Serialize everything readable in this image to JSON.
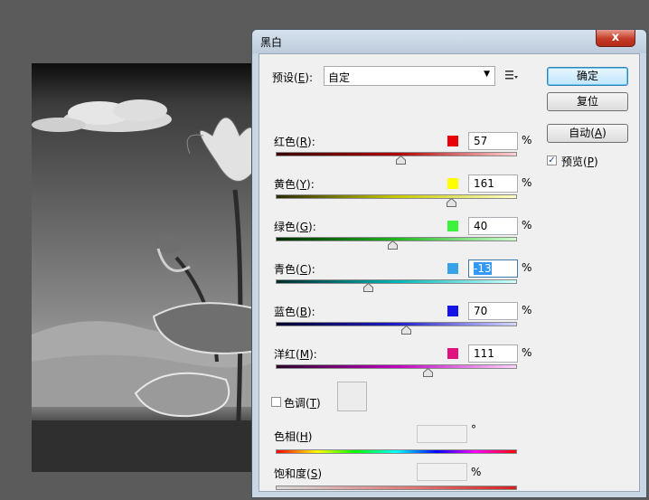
{
  "dialog": {
    "title": "黑白",
    "close_symbol": "x",
    "preset": {
      "label": "预设",
      "key": "E",
      "value": "自定"
    },
    "buttons": {
      "ok": "确定",
      "reset": "复位",
      "auto": "自动",
      "auto_key": "A"
    },
    "preview": {
      "label": "预览",
      "key": "P",
      "checked": true
    },
    "sliders": [
      {
        "label": "红色",
        "key": "R",
        "value": "57",
        "swatch": "#e8000b",
        "track": "linear-gradient(90deg,#3a0000,#b00000 50%,#ffd2d2)",
        "percent": "%",
        "thumb_fraction": 0.515
      },
      {
        "label": "黄色",
        "key": "Y",
        "value": "161",
        "swatch": "#ffff00",
        "track": "linear-gradient(90deg,#2a2a00,#c9c900 50%,#ffffc8)",
        "percent": "%",
        "thumb_fraction": 0.725
      },
      {
        "label": "绿色",
        "key": "G",
        "value": "40",
        "swatch": "#3cf23c",
        "track": "linear-gradient(90deg,#002a00,#1fb51f 50%,#d0ffd0)",
        "percent": "%",
        "thumb_fraction": 0.483
      },
      {
        "label": "青色",
        "key": "C",
        "value": "-13",
        "swatch": "#36a3e6",
        "track": "linear-gradient(90deg,#002a2a,#00b5b5 50%,#cfffff)",
        "percent": "%",
        "thumb_fraction": 0.383,
        "focused": true
      },
      {
        "label": "蓝色",
        "key": "B",
        "value": "70",
        "swatch": "#1414e6",
        "track": "linear-gradient(90deg,#00002a,#1c1cc9 50%,#d6d6ff)",
        "percent": "%",
        "thumb_fraction": 0.538
      },
      {
        "label": "洋红",
        "key": "M",
        "value": "111",
        "swatch": "#e0107f",
        "track": "linear-gradient(90deg,#2a002a,#c000c0 50%,#ffd4ff)",
        "percent": "%",
        "thumb_fraction": 0.63
      }
    ],
    "tint": {
      "label": "色调",
      "key": "T",
      "checked": false
    },
    "hue": {
      "label": "色相",
      "key": "H",
      "value": "",
      "unit": "°"
    },
    "saturation": {
      "label": "饱和度",
      "key": "S",
      "value": "",
      "unit": "%"
    }
  }
}
